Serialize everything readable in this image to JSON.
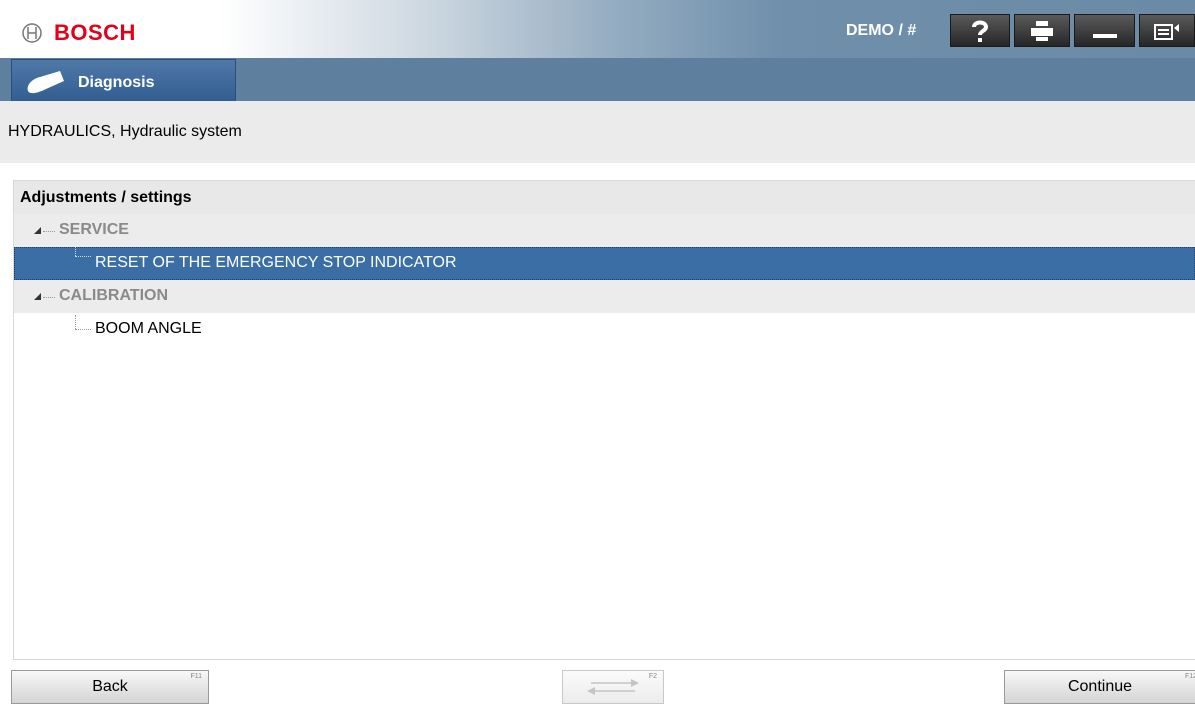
{
  "app": {
    "brand": "BOSCH",
    "user": "DEMO / #"
  },
  "toolbar": {
    "help_icon": "question-mark-icon",
    "print_icon": "printer-icon",
    "minimize_icon": "minimize-icon",
    "menu_icon": "exit-menu-icon"
  },
  "module_tab": {
    "label": "Diagnosis",
    "icon": "diagnosis-plug-icon"
  },
  "breadcrumb": "HYDRAULICS, Hydraulic system",
  "tree": {
    "title": "Adjustments / settings",
    "groups": [
      {
        "label": "SERVICE",
        "items": [
          {
            "label": "RESET OF THE EMERGENCY STOP INDICATOR",
            "selected": true
          }
        ]
      },
      {
        "label": "CALIBRATION",
        "items": [
          {
            "label": "BOOM ANGLE",
            "selected": false
          }
        ]
      }
    ]
  },
  "footer": {
    "back": {
      "label": "Back",
      "key": "F11"
    },
    "switch": {
      "key": "F2",
      "icon": "swap-arrows-icon"
    },
    "continue": {
      "label": "Continue",
      "key": "F12"
    }
  },
  "colors": {
    "brand_red": "#e2001a",
    "header_blue": "#5e7f9e",
    "selection_blue": "#3a6ea5"
  }
}
